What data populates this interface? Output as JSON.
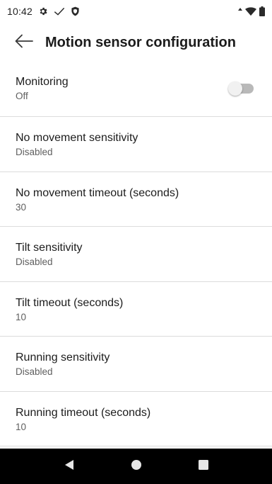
{
  "status_bar": {
    "time": "10:42",
    "left_icons": [
      "gear-icon",
      "check-icon",
      "shield-icon"
    ],
    "right_icons": [
      "data-arrows-icon",
      "wifi-icon",
      "battery-icon"
    ]
  },
  "app_bar": {
    "back_icon": "arrow-left-icon",
    "title": "Motion sensor configuration"
  },
  "settings": {
    "monitoring": {
      "title": "Monitoring",
      "summary": "Off",
      "toggle_on": false
    },
    "no_movement_sensitivity": {
      "title": "No movement sensitivity",
      "summary": "Disabled"
    },
    "no_movement_timeout": {
      "title": "No movement timeout (seconds)",
      "summary": "30"
    },
    "tilt_sensitivity": {
      "title": "Tilt sensitivity",
      "summary": "Disabled"
    },
    "tilt_timeout": {
      "title": "Tilt timeout (seconds)",
      "summary": "10"
    },
    "running_sensitivity": {
      "title": "Running sensitivity",
      "summary": "Disabled"
    },
    "running_timeout": {
      "title": "Running timeout (seconds)",
      "summary": "10"
    }
  },
  "nav_bar": {
    "buttons": [
      "back-triangle-icon",
      "home-circle-icon",
      "recents-square-icon"
    ]
  },
  "colors": {
    "background": "#ffffff",
    "divider": "#dcdcdc",
    "nav_bar": "#000000",
    "toggle_track_off": "#b9b9b9",
    "toggle_thumb_off": "#f1f1f1"
  }
}
